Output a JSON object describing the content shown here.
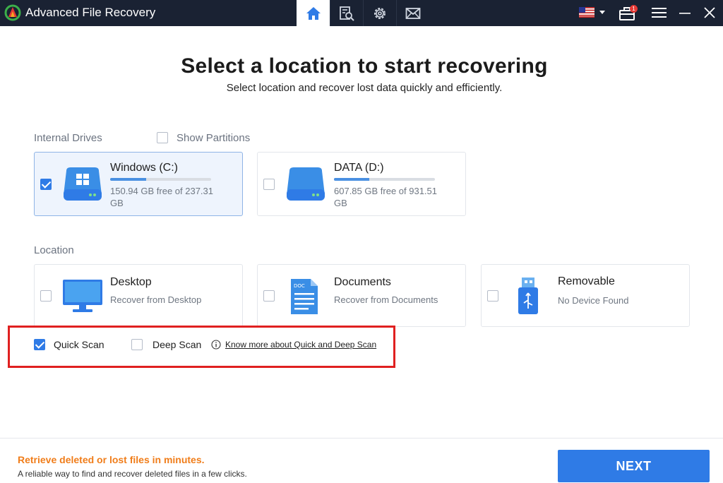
{
  "app": {
    "title": "Advanced File Recovery"
  },
  "topnav": {
    "items": [
      {
        "icon": "home-icon",
        "active": true
      },
      {
        "icon": "scan-report-icon",
        "active": false
      },
      {
        "icon": "gear-icon",
        "active": false
      },
      {
        "icon": "mail-icon",
        "active": false
      }
    ],
    "language_flag": "us-flag-icon",
    "notification_count": "1"
  },
  "heading": {
    "title": "Select a location to start recovering",
    "subtitle": "Select location and recover lost data quickly and efficiently."
  },
  "internal_drives": {
    "label": "Internal Drives",
    "show_partitions_label": "Show Partitions",
    "show_partitions_checked": false,
    "drives": [
      {
        "name": "Windows (C:)",
        "free_line1": "150.94 GB free of 237.31",
        "free_line2": "GB",
        "used_fraction": 0.36,
        "checked": true,
        "icon": "windows-drive-icon"
      },
      {
        "name": "DATA (D:)",
        "free_line1": "607.85 GB free of 931.51",
        "free_line2": "GB",
        "used_fraction": 0.35,
        "checked": false,
        "icon": "hard-drive-icon"
      }
    ]
  },
  "location": {
    "label": "Location",
    "items": [
      {
        "name": "Desktop",
        "sub": "Recover from Desktop",
        "checked": false,
        "icon": "monitor-icon"
      },
      {
        "name": "Documents",
        "sub": "Recover from Documents",
        "checked": false,
        "icon": "document-icon"
      },
      {
        "name": "Removable",
        "sub": "No Device Found",
        "checked": false,
        "icon": "usb-icon"
      }
    ]
  },
  "scan": {
    "quick_label": "Quick Scan",
    "quick_checked": true,
    "deep_label": "Deep Scan",
    "deep_checked": false,
    "link_text": "Know more about Quick and Deep Scan"
  },
  "footer": {
    "tagline": "Retrieve deleted or lost files in minutes.",
    "description": "A reliable way to find and recover deleted files in a few clicks.",
    "next_label": "NEXT"
  },
  "colors": {
    "accent": "#2f7be6",
    "titlebar": "#1a2233",
    "highlight_border": "#e02020",
    "tagline": "#f07d1a"
  }
}
